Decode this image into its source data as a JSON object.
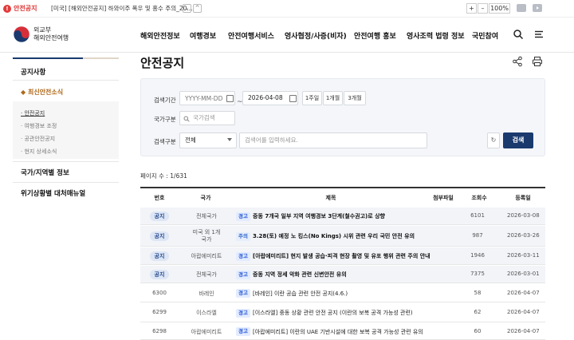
{
  "alert": {
    "badge": "!",
    "label": "안전공지",
    "text": "[미국] [해외안전공지] 하와이주 폭우 및 홍수 주의_20...",
    "down": "⌄",
    "up": "^",
    "zoom_plus": "+",
    "zoom_minus": "–",
    "zoom_level": "100%"
  },
  "header": {
    "org_line1": "외교부",
    "org_line2": "해외안전여행",
    "nav": [
      "해외안전정보",
      "여행경보",
      "안전여행서비스",
      "영사협정/사증(비자)",
      "안전여행 홍보",
      "영사조력 법령 정보",
      "국민참여"
    ]
  },
  "sidebar": {
    "items": [
      "공지사항",
      "최신안전소식",
      "국가/지역별 정보",
      "위기상황별 대처매뉴얼"
    ],
    "current_marker": "◆",
    "sub": [
      "안전공지",
      "여행경보 조정",
      "공관안전공지",
      "현지 상세소식"
    ]
  },
  "page": {
    "title": "안전공지"
  },
  "search": {
    "period_label": "검색기간",
    "start_placeholder": "YYYY-MM-DD",
    "tilde": "~",
    "end_value": "2026-04-08",
    "btn_1w": "1주일",
    "btn_1m": "1개월",
    "btn_3m": "3개월",
    "country_label": "국가구분",
    "country_placeholder": "국가검색",
    "type_label": "검색구분",
    "type_value": "전체",
    "keyword_placeholder": "검색어를 입력하세요.",
    "refresh": "↻",
    "submit": "검색"
  },
  "list": {
    "count": "페이지 수 : 1/631",
    "columns": [
      "번호",
      "국가",
      "제목",
      "첨부파일",
      "조회수",
      "등록일"
    ],
    "rows": [
      {
        "no": "공지",
        "notice": true,
        "country": "전체국가",
        "tag": "경고",
        "title": "중동 7개국 일부 지역 여행경보 3단계(철수권고)로 상향",
        "views": "6101",
        "date": "2026-03-08"
      },
      {
        "no": "공지",
        "notice": true,
        "country": "미국 외 1개 국가",
        "tag": "주의",
        "title": "3.28(토) 예정 노 킹스(No Kings) 시위 관련 우리 국민 안전 유의",
        "views": "987",
        "date": "2026-03-26"
      },
      {
        "no": "공지",
        "notice": true,
        "country": "아랍에미리트",
        "tag": "경고",
        "title": "[아랍에미리트] 현지 발생 공습·피격 현장 촬영 및 유포 행위 관련 주의 안내",
        "views": "1946",
        "date": "2026-03-11"
      },
      {
        "no": "공지",
        "notice": true,
        "country": "전체국가",
        "tag": "경고",
        "title": "중동 지역 정세 악화 관련 신변안전 유의",
        "views": "7375",
        "date": "2026-03-01"
      },
      {
        "no": "6300",
        "notice": false,
        "country": "바레인",
        "tag": "경고",
        "title": "[바레인] 이란 공습 관련 안전 공지(4.6.)",
        "views": "58",
        "date": "2026-04-07"
      },
      {
        "no": "6299",
        "notice": false,
        "country": "이스라엘",
        "tag": "경고",
        "title": "[이스라엘] 중동 상황 관련 안전 공지 (이란의 보복 공격 가능성 관련)",
        "views": "62",
        "date": "2026-04-07"
      },
      {
        "no": "6298",
        "notice": false,
        "country": "아랍에미리트",
        "tag": "경고",
        "title": "[아랍에미리트] 이란의 UAE 기반시설에 대한 보복 공격 가능성 관련 유의",
        "views": "60",
        "date": "2026-04-07"
      }
    ]
  },
  "colors": {
    "brand_navy": "#1a3a6e",
    "alert_red": "#e23b3b",
    "accent_brown": "#b06a1c"
  }
}
